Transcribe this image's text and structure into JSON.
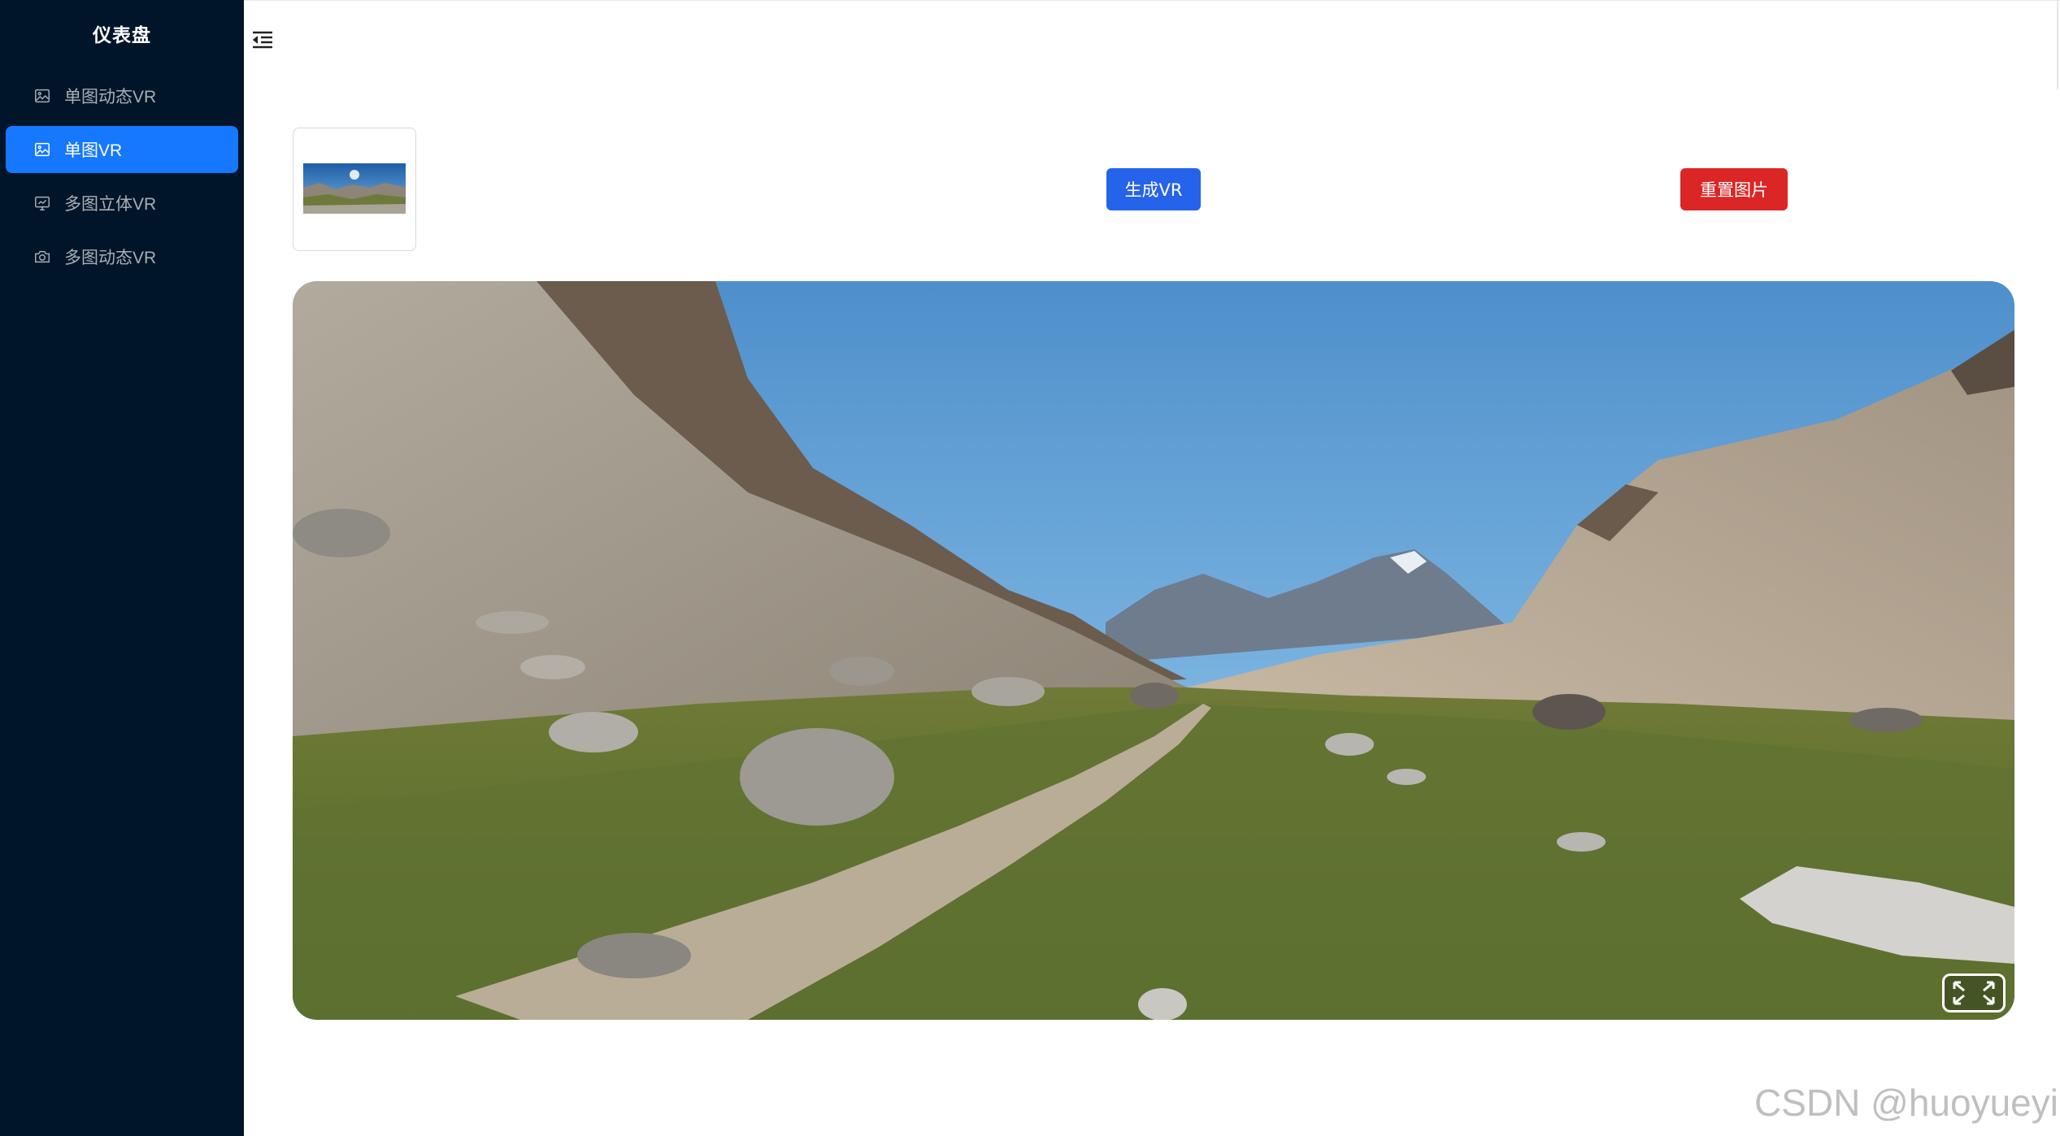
{
  "sidebar": {
    "title": "仪表盘",
    "items": [
      {
        "label": "单图动态VR",
        "icon": "picture-icon",
        "active": false
      },
      {
        "label": "单图VR",
        "icon": "picture-icon",
        "active": true
      },
      {
        "label": "多图立体VR",
        "icon": "chart-monitor-icon",
        "active": false
      },
      {
        "label": "多图动态VR",
        "icon": "camera-icon",
        "active": false
      }
    ]
  },
  "header": {
    "menu_fold_icon": "menu-fold-icon"
  },
  "toolbar": {
    "thumbnail_icon": "panorama-thumbnail",
    "generate_label": "生成VR",
    "reset_label": "重置图片"
  },
  "viewer": {
    "fullscreen_icon": "fullscreen-icon"
  },
  "watermark": "CSDN @huoyueyi",
  "colors": {
    "sidebar_bg": "#001529",
    "active_item": "#1677ff",
    "primary_button": "#2563eb",
    "danger_button": "#dc2626"
  }
}
